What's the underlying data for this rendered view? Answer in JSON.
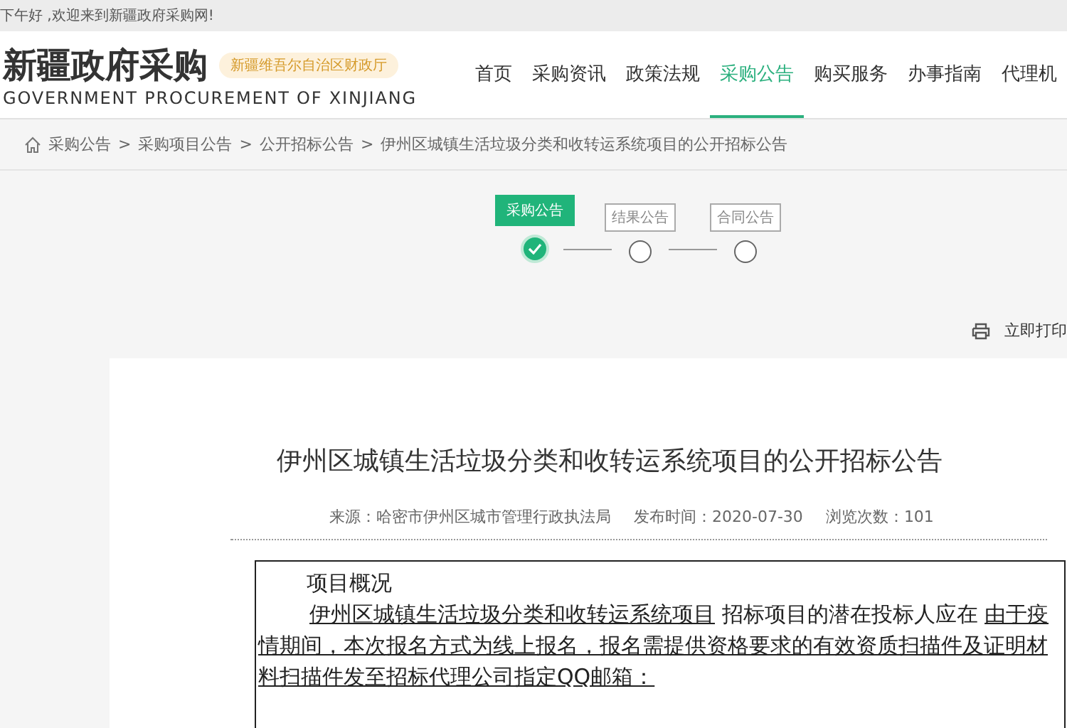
{
  "top_bar": {
    "greeting": "下午好 ,欢迎来到新疆政府采购网!"
  },
  "header": {
    "logo_title": "新疆政府采购",
    "logo_subtitle": "GOVERNMENT PROCUREMENT OF XINJIANG",
    "badge": "新疆维吾尔自治区财政厅",
    "nav": [
      {
        "label": "首页",
        "selected": false
      },
      {
        "label": "采购资讯",
        "selected": false
      },
      {
        "label": "政策法规",
        "selected": false
      },
      {
        "label": "采购公告",
        "selected": true
      },
      {
        "label": "购买服务",
        "selected": false
      },
      {
        "label": "办事指南",
        "selected": false
      },
      {
        "label": "代理机",
        "selected": false
      }
    ]
  },
  "breadcrumb": {
    "separator": ">",
    "items": [
      "采购公告",
      "采购项目公告",
      "公开招标公告",
      "伊州区城镇生活垃圾分类和收转运系统项目的公开招标公告"
    ]
  },
  "steps": [
    {
      "label": "采购公告",
      "done": true
    },
    {
      "label": "结果公告",
      "done": false
    },
    {
      "label": "合同公告",
      "done": false
    }
  ],
  "print_label": "立即打印",
  "article": {
    "title": "伊州区城镇生活垃圾分类和收转运系统项目的公开招标公告",
    "meta": [
      {
        "label": "来源：",
        "value": "哈密市伊州区城市管理行政执法局"
      },
      {
        "label": "发布时间：",
        "value": "2020-07-30"
      },
      {
        "label": "浏览次数：",
        "value": "101"
      }
    ],
    "section_heading": "项目概况",
    "paragraph": [
      {
        "text": "伊州区城镇生活垃圾分类和收转运系统项目",
        "underlined": true
      },
      {
        "text": " 招标项目的潜在投标人应在 ",
        "underlined": false
      },
      {
        "text": "由于疫情期间，本次报名方式为线上报名，报名需提供资格要求的有效资质扫描件及证明材料扫描件发至招标代理公司指定QQ邮箱：",
        "underlined": true
      }
    ]
  }
}
